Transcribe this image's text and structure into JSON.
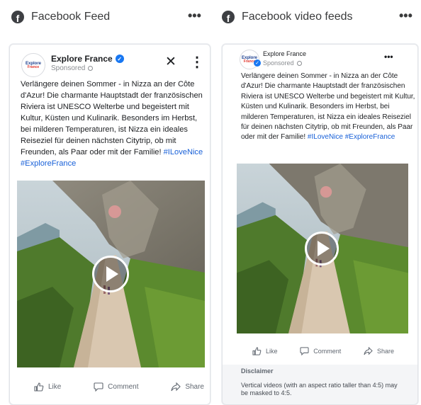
{
  "columns": [
    {
      "header": {
        "title": "Facebook Feed",
        "icon": "facebook-icon",
        "menu": "•••"
      },
      "post": {
        "page_name": "Explore France",
        "sponsored": "Sponsored",
        "logo_text_top": "Explore",
        "logo_text_bottom": "France",
        "body_line_1": "Verlängere deinen Sommer - in Nizza an der Côte d'Azur! Die charmante Hauptstadt der französischen Riviera ist UNESCO Welterbe und begeistert mit Kultur, Küsten und Kulinarik. Besonders im Herbst, bei milderen Temperaturen, ist Nizza ein ideales Reiseziel für deinen nächsten Citytrip, ob mit Freunden, als Paar oder mit der Familie!",
        "hashtag_1": "#ILoveNice",
        "hashtag_2": "#ExploreFrance",
        "close_glyph": "✕",
        "more_glyph": "⋮"
      },
      "actions": {
        "like": "Like",
        "comment": "Comment",
        "share": "Share"
      }
    },
    {
      "header": {
        "title": "Facebook video feeds",
        "icon": "facebook-icon",
        "menu": "•••"
      },
      "post": {
        "page_name": "Explore France",
        "sponsored": "Sponsored",
        "logo_text_top": "Explore",
        "logo_text_bottom": "France",
        "body_line_1": "Verlängere deinen Sommer - in Nizza an der Côte d'Azur! Die charmante Hauptstadt der französischen Riviera ist UNESCO Welterbe und begeistert mit Kultur, Küsten und Kulinarik. Besonders im Herbst, bei milderen Temperaturen, ist Nizza ein ideales Reiseziel für deinen nächsten Citytrip, ob mit Freunden, als Paar oder mit der Familie!",
        "hashtag_1": "#ILoveNice",
        "hashtag_2": "#ExploreFrance",
        "more_glyph": "•••"
      },
      "actions": {
        "like": "Like",
        "comment": "Comment",
        "share": "Share"
      },
      "disclaimer": {
        "title": "Disclaimer",
        "text": "Vertical videos (with an aspect ratio taller than 4:5) may be masked to 4:5."
      }
    }
  ],
  "colors": {
    "accent": "#1877f2",
    "hashtag": "#1860d8",
    "muted": "#8a8d91"
  }
}
